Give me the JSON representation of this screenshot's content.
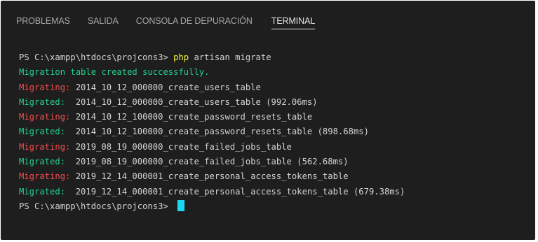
{
  "panel": {
    "tabs": [
      {
        "label": "PROBLEMAS",
        "active": false
      },
      {
        "label": "SALIDA",
        "active": false
      },
      {
        "label": "CONSOLA DE DEPURACIÓN",
        "active": false
      },
      {
        "label": "TERMINAL",
        "active": true
      }
    ]
  },
  "terminal": {
    "prompt1": "PS C:\\xampp\\htdocs\\projcons3> ",
    "command_php": "php",
    "command_rest": " artisan migrate",
    "created_msg": "Migration table created successfully.",
    "lines": [
      {
        "tag": "Migrating: ",
        "text": "2014_10_12_000000_create_users_table"
      },
      {
        "tag": "Migrated:  ",
        "text": "2014_10_12_000000_create_users_table (992.06ms)"
      },
      {
        "tag": "Migrating: ",
        "text": "2014_10_12_100000_create_password_resets_table"
      },
      {
        "tag": "Migrated:  ",
        "text": "2014_10_12_100000_create_password_resets_table (898.68ms)"
      },
      {
        "tag": "Migrating: ",
        "text": "2019_08_19_000000_create_failed_jobs_table"
      },
      {
        "tag": "Migrated:  ",
        "text": "2019_08_19_000000_create_failed_jobs_table (562.68ms)"
      },
      {
        "tag": "Migrating: ",
        "text": "2019_12_14_000001_create_personal_access_tokens_table"
      },
      {
        "tag": "Migrated:  ",
        "text": "2019_12_14_000001_create_personal_access_tokens_table (679.38ms)"
      }
    ],
    "prompt2": "PS C:\\xampp\\htdocs\\projcons3> "
  },
  "colors": {
    "background": "#1e1e1e",
    "success": "#23d18b",
    "error": "#f14c4c",
    "command": "#f5f543",
    "cursor": "#1ad8f0"
  }
}
